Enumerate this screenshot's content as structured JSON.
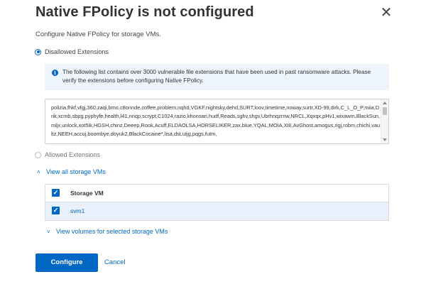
{
  "dialog": {
    "title": "Native FPolicy is not configured",
    "close_icon": "close-icon",
    "subtitle": "Configure Native FPolicy for storage VMs."
  },
  "options": {
    "disallowed": {
      "label": "Disallowed Extensions",
      "selected": true
    },
    "allowed": {
      "label": "Allowed Extensions",
      "selected": false
    }
  },
  "info": {
    "icon": "info-icon",
    "text": "The following list contains over 3000 vulnerable file extensions that have been used in past ransomware attacks. Please verify the extensions before configuring Native FPolicy."
  },
  "extensions": {
    "value": "polizia,fhkf,vfgj,360,zaqi,bmo,c8onnde,coffee,problem,nqhd,VGKF,nightsky,dehd,SURT,loov,timetime,noway,surtr,XD-99,dirk,C_L_O_P,miia,Drik,xcmb,sbpg,pyphyfe,health,l41,nnqp,scrypt,C1024,razio,khonsari,hudf,Reads,sghv,shgv,Ubrhnqzrnw,NRCL,Xqxqx,pHv1,wixawm,BlackSun,mljx,unlock,xot5ik,HGSH,chinz,Deeep,Rook,Acuff,ELDAOLSA,HORSELIKER,zax,blue,YQAL,MOIA,XIII,AvGhost,amogus,rigj,robm,chichi,vaultz,NEEH,accuj,boombye,doyuk2,BlackCocaine*,lisa,dst,utjg,pqgs,futm,"
  },
  "links": {
    "view_all_vms": "View all storage VMs",
    "view_volumes": "View volumes for selected storage VMs"
  },
  "table": {
    "header": "Storage VM",
    "rows": [
      {
        "name": "svm1",
        "checked": true
      }
    ],
    "select_all_checked": true
  },
  "actions": {
    "configure": "Configure",
    "cancel": "Cancel"
  },
  "colors": {
    "accent": "#0067c5",
    "info_bg": "#eef4fb",
    "row_selected_bg": "#e8f1fb"
  }
}
